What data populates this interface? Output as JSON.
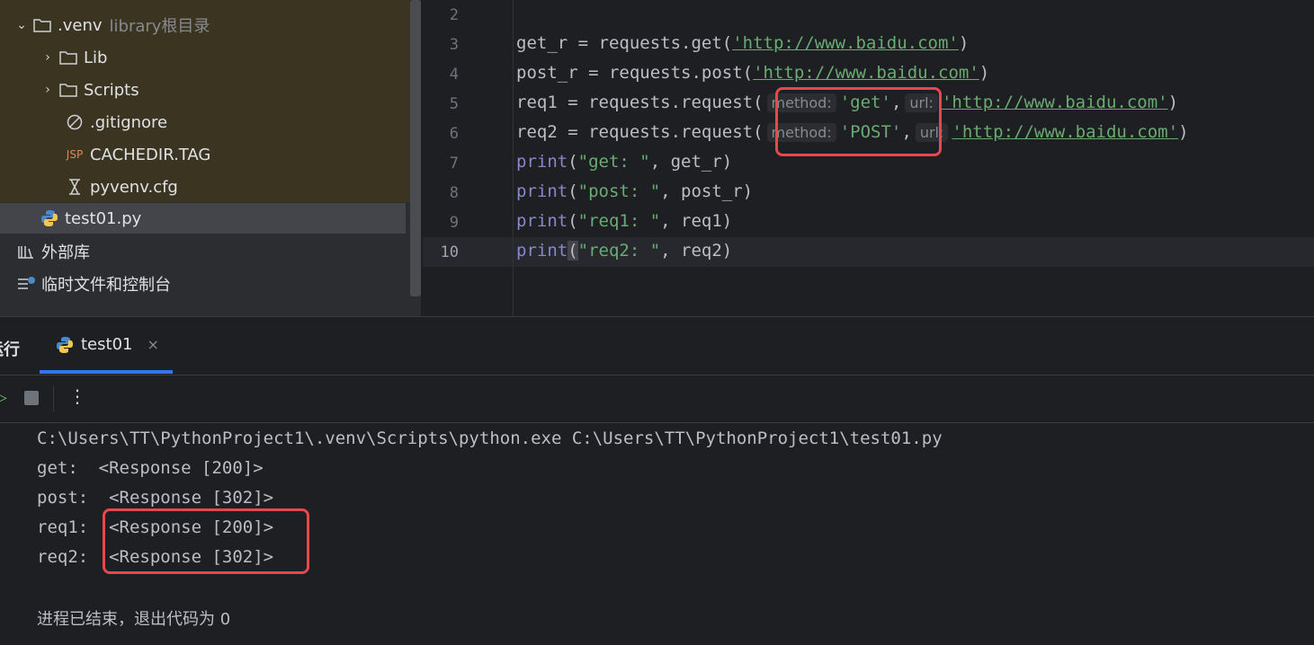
{
  "project_tree": {
    "items": [
      {
        "label": ".venv",
        "hint": "library根目录",
        "type": "folder",
        "expanded": true
      },
      {
        "label": "Lib",
        "type": "folder",
        "expanded": false
      },
      {
        "label": "Scripts",
        "type": "folder",
        "expanded": false
      },
      {
        "label": ".gitignore",
        "type": "ignore-file"
      },
      {
        "label": "CACHEDIR.TAG",
        "type": "jsp-file",
        "icon_text": "JSP"
      },
      {
        "label": "pyvenv.cfg",
        "type": "cfg-file"
      },
      {
        "label": "test01.py",
        "type": "python-file",
        "selected": true
      },
      {
        "label": "外部库",
        "type": "library"
      },
      {
        "label": "临时文件和控制台",
        "type": "scratches"
      }
    ]
  },
  "editor": {
    "line_numbers": [
      "2",
      "3",
      "4",
      "5",
      "6",
      "7",
      "8",
      "9",
      "10"
    ],
    "current_line": "10",
    "lines": {
      "l3": {
        "var": "get_r = requests.get(",
        "url": "'http://www.baidu.com'",
        "end": ")"
      },
      "l4": {
        "var": "post_r = requests.post(",
        "url": "'http://www.baidu.com'",
        "end": ")"
      },
      "l5": {
        "var": "req1 = requests.request(",
        "hint1": "method:",
        "arg1": "'get'",
        "comma": ",",
        "hint2": "url:",
        "url": "'http://www.baidu.com'",
        "end": ")"
      },
      "l6": {
        "var": "req2 = requests.request(",
        "hint1": "method:",
        "arg1": "'POST'",
        "comma": ",",
        "hint2": "url:",
        "url": "'http://www.baidu.com'",
        "end": ")"
      },
      "l7": {
        "fn": "print",
        "open": "(",
        "str": "\"get: \"",
        "rest": ", get_r)"
      },
      "l8": {
        "fn": "print",
        "open": "(",
        "str": "\"post: \"",
        "rest": ", post_r)"
      },
      "l9": {
        "fn": "print",
        "open": "(",
        "str": "\"req1: \"",
        "rest": ", req1)"
      },
      "l10": {
        "fn": "print",
        "open": "(",
        "str": "\"req2: \"",
        "rest": ", req2)"
      }
    }
  },
  "run_panel": {
    "title": "运行",
    "tab_label": "test01",
    "close_glyph": "×",
    "more_glyph": "⋮",
    "rerun_glyph": "▷",
    "output": [
      "C:\\Users\\TT\\PythonProject1\\.venv\\Scripts\\python.exe C:\\Users\\TT\\PythonProject1\\test01.py",
      "get:  <Response [200]>",
      "post:  <Response [302]>",
      "req1:  <Response [200]>",
      "req2:  <Response [302]>",
      "",
      "进程已结束，退出代码为 0"
    ]
  },
  "colors": {
    "highlight_box": "#e5484d",
    "string": "#6aab73",
    "builtin": "#8888c6",
    "tab_underline": "#3574f0"
  }
}
